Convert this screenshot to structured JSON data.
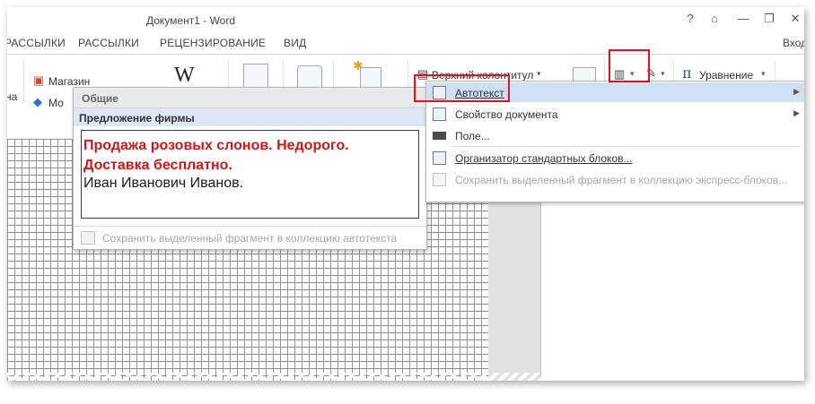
{
  "window": {
    "title": "Документ1 - Word",
    "controls": {
      "help": "?",
      "ribbon_options": "⌂",
      "minimize": "—",
      "restore": "❐",
      "close": "✕"
    }
  },
  "tabs": {
    "items": [
      "РАССЫЛКИ",
      "РАССЫЛКИ",
      "РЕЦЕНЗИРОВАНИЕ",
      "ВИД"
    ],
    "signin": "Вход"
  },
  "ribbon": {
    "left_partial": "на",
    "store": "Магазин",
    "my_apps_partial": "Мо",
    "wikipedia": "W",
    "header_button": "Верхний колонтитул",
    "equation_button": "Уравнение",
    "pi_symbol": "π",
    "dropdown_arrow": "▾"
  },
  "autotext_gallery": {
    "category": "Общие",
    "entry_name": "Предложение фирмы",
    "preview_text_red": "Продажа розовых слонов. Недорого. Доставка бесплатно.",
    "preview_text_name": "Иван Иванович Иванов.",
    "save_selection": "Сохранить выделенный фрагмент в коллекцию автотекста"
  },
  "quick_parts_menu": {
    "items": [
      {
        "label": "Автотекст",
        "has_submenu": true
      },
      {
        "label": "Свойство документа",
        "has_submenu": true
      },
      {
        "label": "Поле...",
        "has_submenu": false
      },
      {
        "label": "Организатор стандартных блоков...",
        "has_submenu": false
      },
      {
        "label": "Сохранить выделенный фрагмент в коллекцию экспресс-блоков...",
        "has_submenu": false
      }
    ],
    "submenu_arrow": "▶"
  },
  "colors": {
    "highlight_red": "#e0141b",
    "menu_highlight": "#cfe0f5",
    "preview_red_text": "#d01616",
    "disabled_text": "#a7a7a7"
  }
}
